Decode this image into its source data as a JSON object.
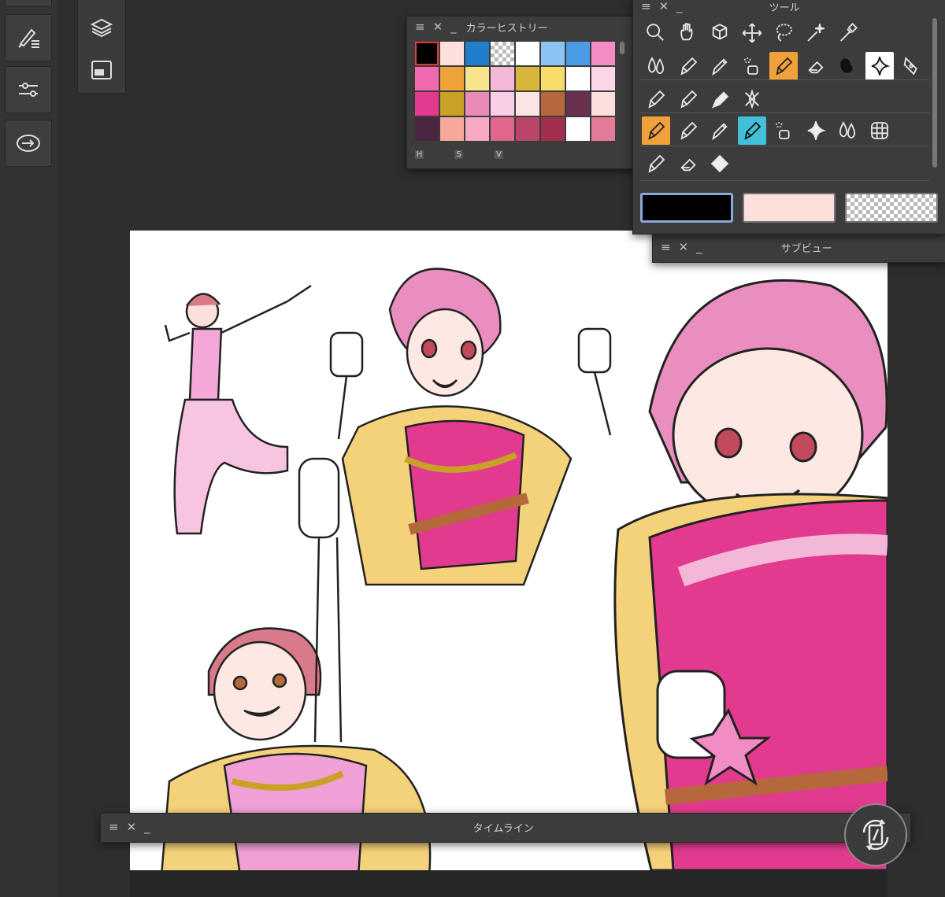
{
  "app": {
    "panels": {
      "color_history": {
        "title": "カラーヒストリー",
        "mode_labels": [
          "H",
          "S",
          "V"
        ],
        "swatches": [
          "#000000",
          "#fde0dc",
          "#1f7fcc",
          "transparent",
          "#ffffff",
          "#8cc2f4",
          "#4a9ae6",
          "#f28cc4",
          "#f06ab0",
          "#f0a23a",
          "#f7e48c",
          "#f3b8d8",
          "#d8b63a",
          "#f7dc6a",
          "#ffffff",
          "#fcd6e6",
          "#e23a8e",
          "#c9a126",
          "#e98ab8",
          "#f8cfe6",
          "#fde4e4",
          "#b5683c",
          "#6a3050",
          "#fde0dc",
          "#4a2640",
          "#f7a89a",
          "#f7a8c4",
          "#e0668c",
          "#b9466a",
          "#a0304e",
          "#ffffff",
          "#e47a9a"
        ]
      },
      "tool": {
        "title": "ツール",
        "rows": [
          [
            "zoom-icon",
            "hand-icon",
            "rotate-view-icon",
            "move-icon",
            "lasso-icon",
            "magic-wand-icon",
            "eyedropper-icon"
          ],
          [
            "blend-icon",
            "pen-icon",
            "pencil-icon",
            "airbrush-icon",
            "pen-selected-icon",
            "eraser-icon",
            "ink-blot-icon",
            "sparkle-icon",
            "vector-pen-icon"
          ],
          [
            "pen-icon",
            "pen-icon",
            "marker-icon",
            "ruler-cross-icon"
          ],
          [
            "pen-selected-icon",
            "pen-icon",
            "pencil-icon",
            "brush-alt-icon",
            "airbrush-icon",
            "sparkle-icon",
            "blend-icon",
            "grid-icon"
          ],
          [
            "pen-icon",
            "eraser-icon",
            "fill-icon"
          ]
        ],
        "colors": {
          "main": "#000000",
          "sub": "#fde0dc",
          "transparent": "transparent"
        }
      },
      "sub_view": {
        "title": "サブビュー"
      },
      "timeline": {
        "title": "タイムライン"
      }
    },
    "icons": {
      "left_rail": [
        "brush-settings-icon",
        "adjust-sliders-icon",
        "swap-icon"
      ],
      "second_rail": [
        "layers-icon",
        "navigator-icon"
      ],
      "fab": "rotate-canvas-icon",
      "panel_controls": [
        "menu-icon",
        "close-icon",
        "minimize-icon"
      ]
    }
  }
}
